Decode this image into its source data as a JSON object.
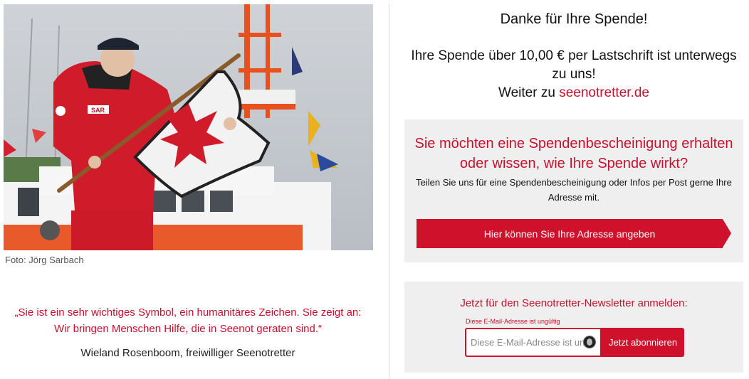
{
  "photo": {
    "caption": "Foto: Jörg Sarbach",
    "jacket_badge": "SAR"
  },
  "quote": {
    "text": "„Sie ist ein sehr wichtiges Symbol, ein humanitäres Zeichen. Sie zeigt an: Wir bringen Menschen Hilfe, die in Seenot geraten sind.“",
    "author": "Wieland Rosenboom, freiwilliger Seenotretter"
  },
  "thanks": {
    "title": "Danke für Ihre Spende!",
    "line1": "Ihre Spende über 10,00 € per Lastschrift ist unterwegs zu uns!",
    "line2_prefix": "Weiter zu ",
    "link": "seenotretter.de"
  },
  "certificate": {
    "title": "Sie möchten eine Spendenbescheinigung erhalten oder wissen, wie Ihre Spende wirkt?",
    "text": "Teilen Sie uns für eine Spendenbescheinigung oder Infos per Post gerne Ihre Adresse mit.",
    "button": "Hier können Sie Ihre Adresse angeben"
  },
  "newsletter": {
    "title": "Jetzt für den Seenotretter-Newsletter anmelden:",
    "error": "Diese E-Mail-Adresse ist ungültig",
    "placeholder": "Diese E-Mail-Adresse ist ungültig",
    "button": "Jetzt abonnieren"
  },
  "colors": {
    "accent": "#c8102e",
    "button": "#d0112b",
    "box_bg": "#efefef"
  }
}
